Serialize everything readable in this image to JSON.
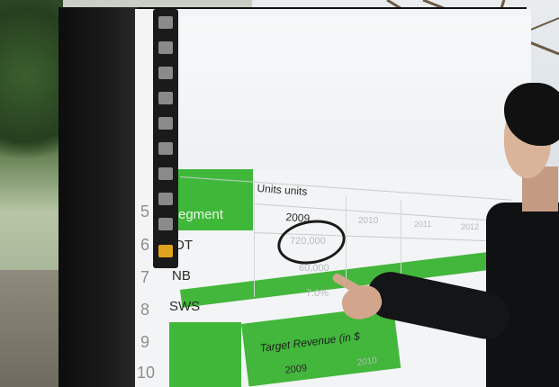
{
  "scene": {
    "description_colors": {
      "accent_green": "#3fb83a",
      "screen_bg": "#f2f4f5",
      "bezel": "#111111"
    }
  },
  "row_numbers": [
    "5",
    "6",
    "7",
    "8",
    "9",
    "10"
  ],
  "table": {
    "header_label": "Units units",
    "segment_label": "egment",
    "years": [
      "2009",
      "2010",
      "2011",
      "2012"
    ],
    "rows": [
      {
        "label": "DT",
        "values": [
          "720,000",
          "",
          "",
          ""
        ]
      },
      {
        "label": "NB",
        "values": [
          "60,000",
          "",
          "",
          ""
        ]
      },
      {
        "label": "SWS",
        "values": [
          "7.0%",
          "",
          "",
          ""
        ]
      }
    ],
    "revenue_label": "Target Revenue (in $",
    "revenue_years": [
      "2009",
      "2010"
    ]
  },
  "toolbar": {
    "tools": [
      "pointer-icon",
      "page-icon",
      "pen-icon",
      "pen-icon",
      "pen-icon",
      "marker-icon",
      "skip-back-icon",
      "skip-forward-icon",
      "minus-icon",
      "folder-icon"
    ]
  }
}
